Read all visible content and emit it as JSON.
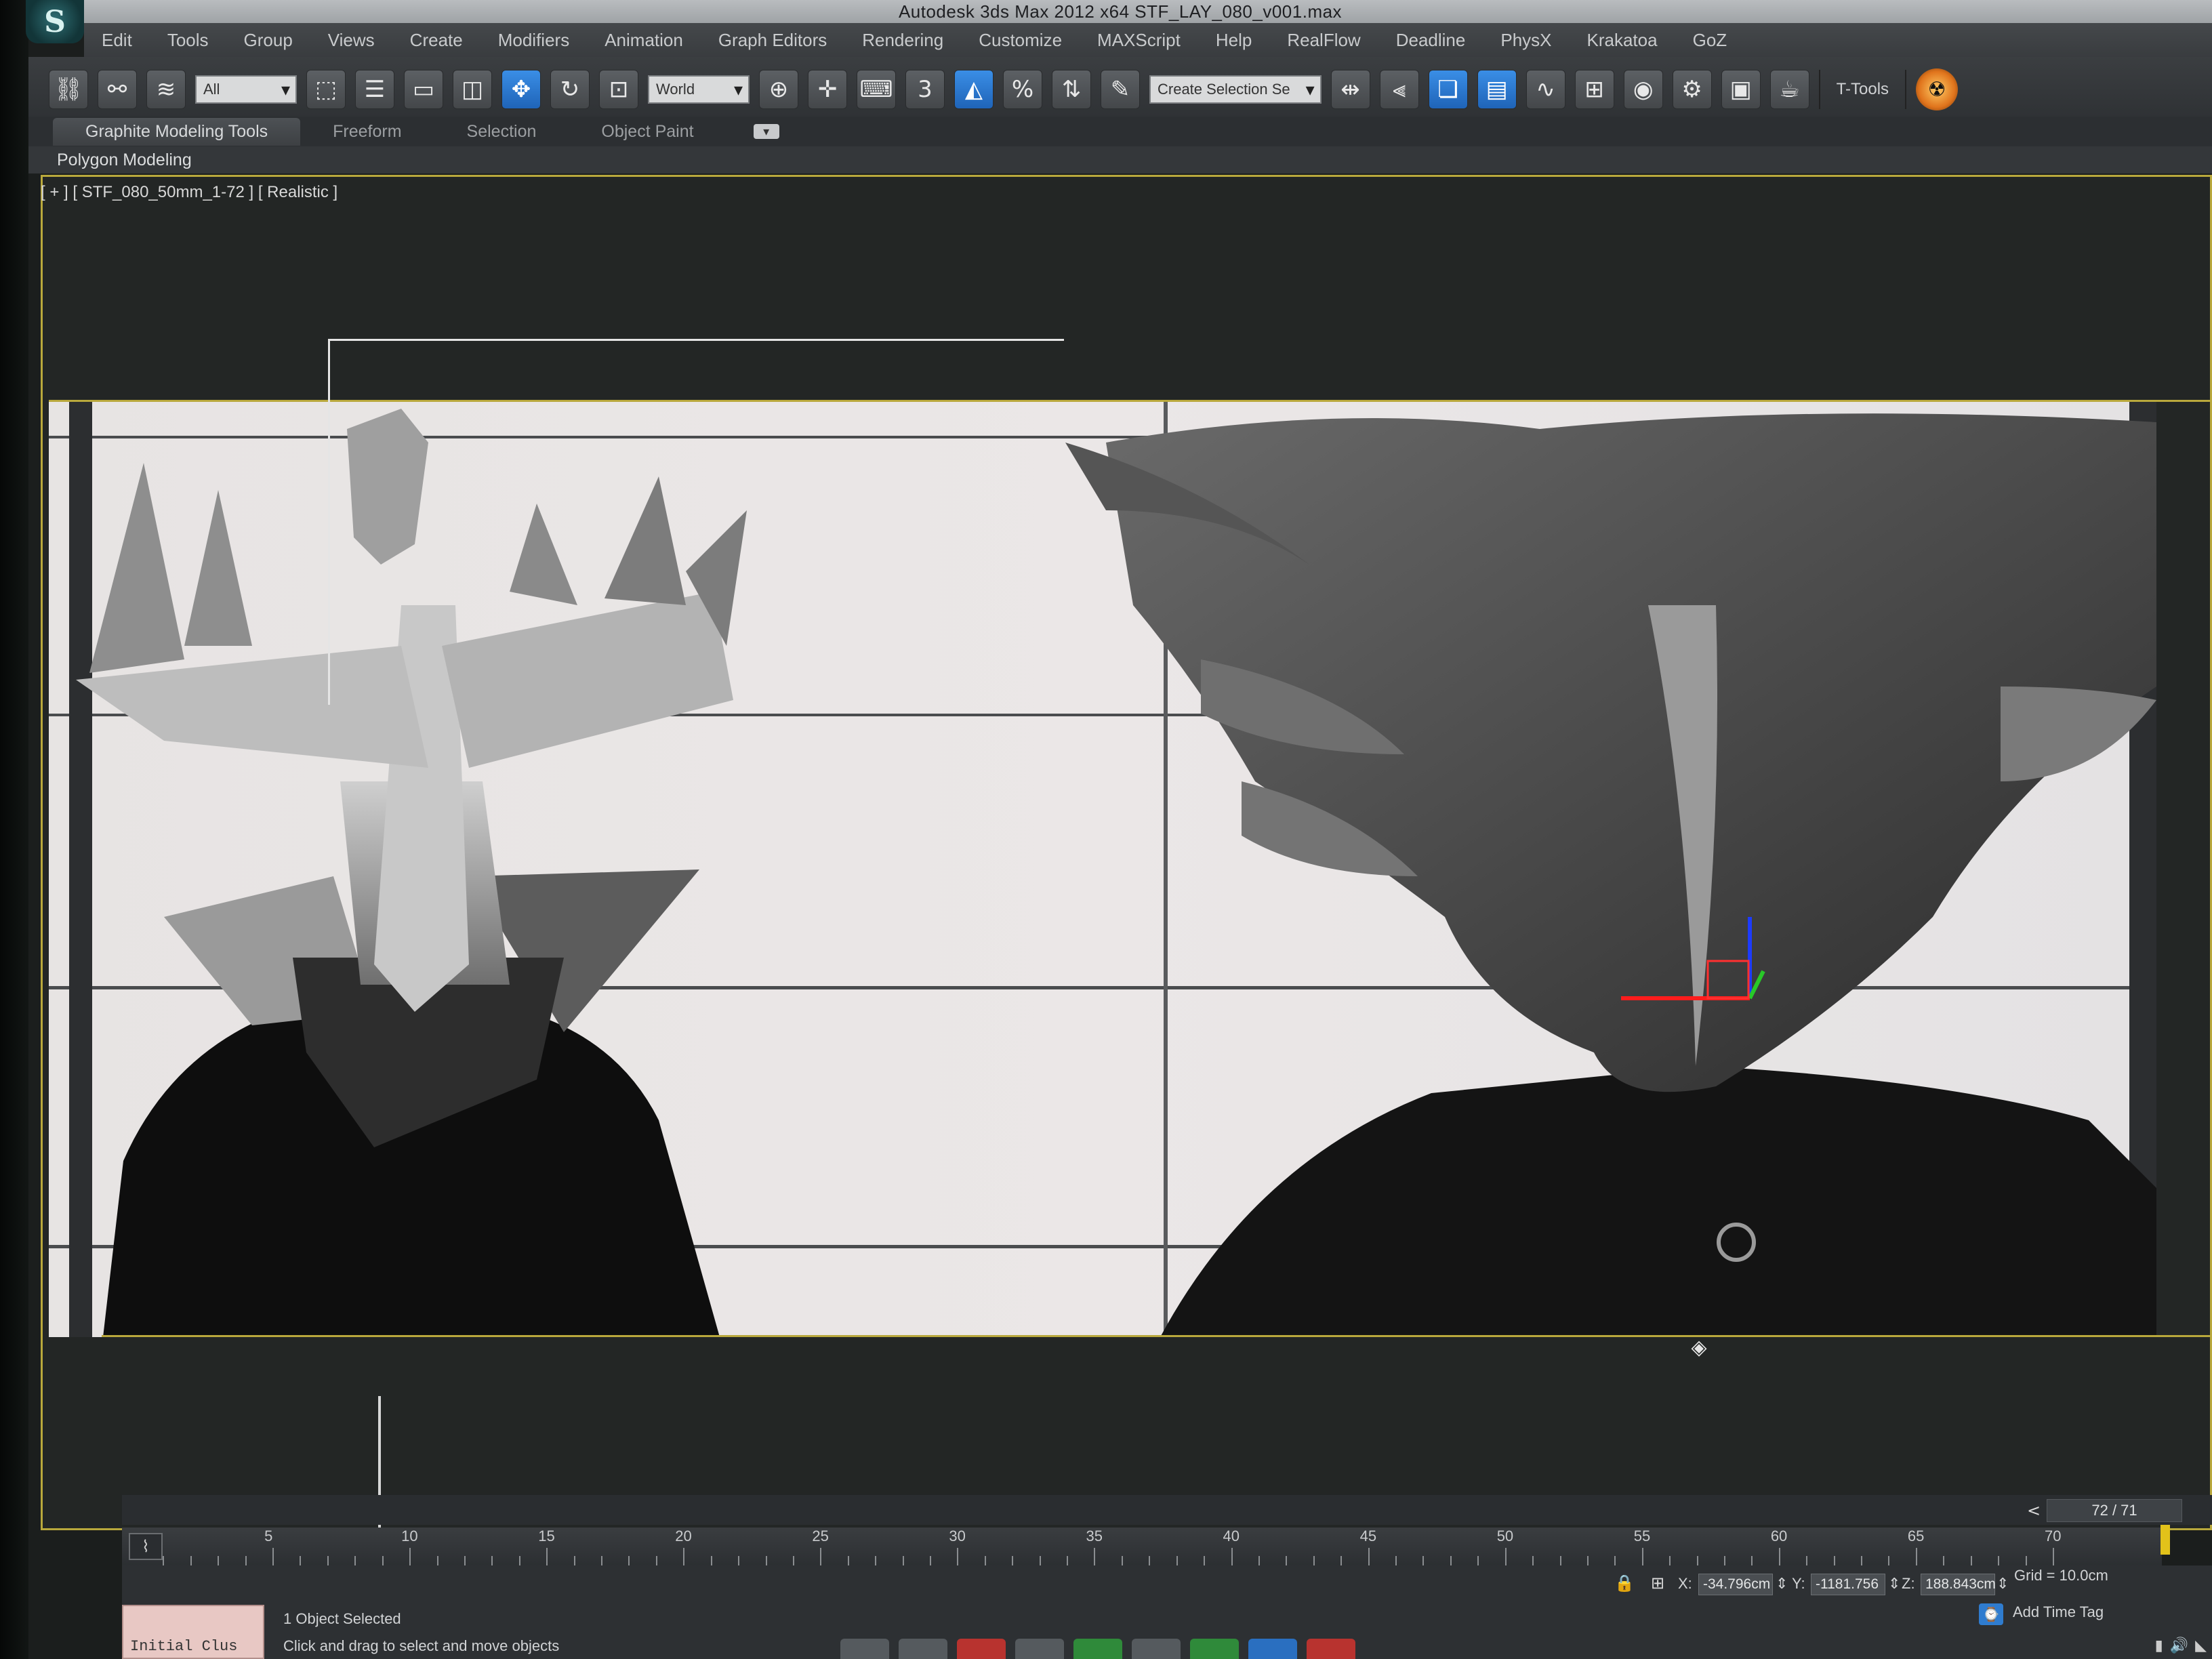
{
  "window": {
    "title": "Autodesk 3ds Max  2012 x64      STF_LAY_080_v001.max"
  },
  "menu": [
    "Edit",
    "Tools",
    "Group",
    "Views",
    "Create",
    "Modifiers",
    "Animation",
    "Graph Editors",
    "Rendering",
    "Customize",
    "MAXScript",
    "Help",
    "RealFlow",
    "Deadline",
    "PhysX",
    "Krakatoa",
    "GoZ"
  ],
  "toolbar": {
    "selection_filter": "All",
    "reference_coord": "World",
    "named_selection_placeholder": "Create Selection Se",
    "ttools_label": "T-Tools"
  },
  "ribbon": {
    "tabs": [
      "Graphite Modeling Tools",
      "Freeform",
      "Selection",
      "Object Paint"
    ],
    "active_tab": "Graphite Modeling Tools",
    "panel": "Polygon Modeling"
  },
  "viewport": {
    "label": "[ + ] [ STF_080_50mm_1-72 ] [ Realistic ]",
    "frame_color": "#b9a83c"
  },
  "timeline": {
    "slider_readout": "72 / 71",
    "current_frame": 72,
    "total_frames": 71,
    "ticks": [
      "5",
      "10",
      "15",
      "20",
      "25",
      "30",
      "35",
      "40",
      "45",
      "50",
      "55",
      "60",
      "65",
      "70"
    ]
  },
  "status": {
    "maxscript_listener": "Initial Clus",
    "selection_info": "1 Object Selected",
    "prompt": "Click and drag to select and move objects",
    "x_label": "X:",
    "x_value": "-34.796cm",
    "y_label": "Y:",
    "y_value": "-1181.756",
    "z_label": "Z:",
    "z_value": "188.843cm",
    "grid": "Grid = 10.0cm",
    "add_time_tag": "Add Time Tag"
  }
}
